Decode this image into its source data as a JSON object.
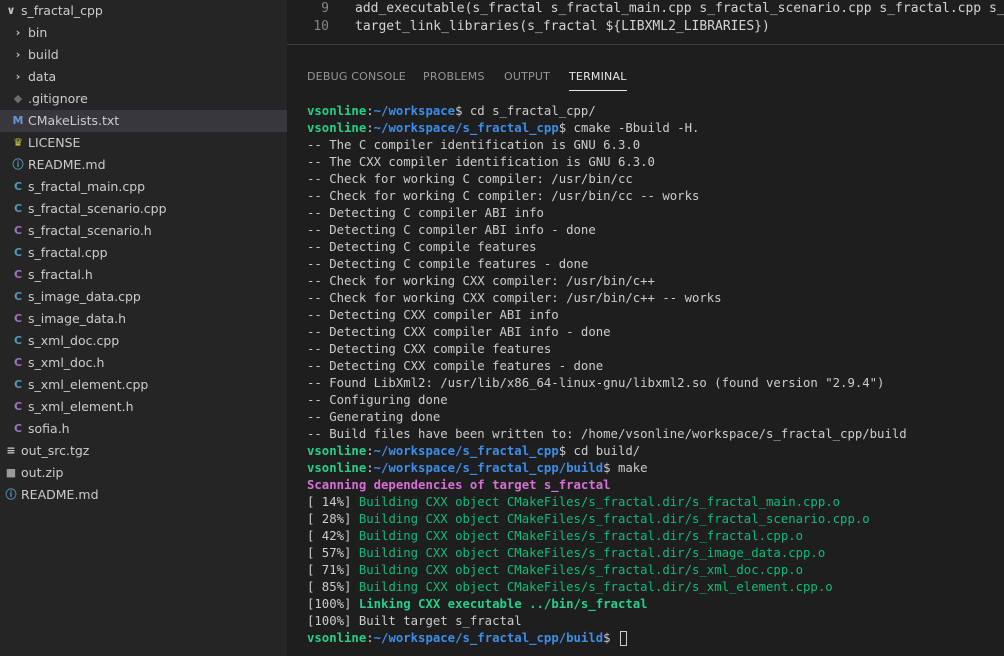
{
  "explorer": {
    "items": [
      {
        "label": "s_fractal_cpp",
        "icon": "chevron-down",
        "glyph": "∨",
        "color": "#c5c5c5",
        "level": 0
      },
      {
        "label": "bin",
        "icon": "chevron-right",
        "glyph": "›",
        "color": "#c5c5c5",
        "level": 1
      },
      {
        "label": "build",
        "icon": "chevron-right",
        "glyph": "›",
        "color": "#c5c5c5",
        "level": 1
      },
      {
        "label": "data",
        "icon": "chevron-right",
        "glyph": "›",
        "color": "#c5c5c5",
        "level": 1
      },
      {
        "label": ".gitignore",
        "icon": "git",
        "glyph": "◆",
        "color": "#6d6d6d",
        "level": 1
      },
      {
        "label": "CMakeLists.txt",
        "icon": "cmake",
        "glyph": "M",
        "color": "#6997d5",
        "level": 1,
        "selected": true
      },
      {
        "label": "LICENSE",
        "icon": "license",
        "glyph": "♛",
        "color": "#cbcb41",
        "level": 1
      },
      {
        "label": "README.md",
        "icon": "info",
        "glyph": "ⓘ",
        "color": "#519aba",
        "level": 1
      },
      {
        "label": "s_fractal_main.cpp",
        "icon": "cpp",
        "glyph": "C",
        "color": "#519aba",
        "level": 1
      },
      {
        "label": "s_fractal_scenario.cpp",
        "icon": "cpp",
        "glyph": "C",
        "color": "#519aba",
        "level": 1
      },
      {
        "label": "s_fractal_scenario.h",
        "icon": "header",
        "glyph": "C",
        "color": "#a074c4",
        "level": 1
      },
      {
        "label": "s_fractal.cpp",
        "icon": "cpp",
        "glyph": "C",
        "color": "#519aba",
        "level": 1
      },
      {
        "label": "s_fractal.h",
        "icon": "header",
        "glyph": "C",
        "color": "#a074c4",
        "level": 1
      },
      {
        "label": "s_image_data.cpp",
        "icon": "cpp",
        "glyph": "C",
        "color": "#519aba",
        "level": 1
      },
      {
        "label": "s_image_data.h",
        "icon": "header",
        "glyph": "C",
        "color": "#a074c4",
        "level": 1
      },
      {
        "label": "s_xml_doc.cpp",
        "icon": "cpp",
        "glyph": "C",
        "color": "#519aba",
        "level": 1
      },
      {
        "label": "s_xml_doc.h",
        "icon": "header",
        "glyph": "C",
        "color": "#a074c4",
        "level": 1
      },
      {
        "label": "s_xml_element.cpp",
        "icon": "cpp",
        "glyph": "C",
        "color": "#519aba",
        "level": 1
      },
      {
        "label": "s_xml_element.h",
        "icon": "header",
        "glyph": "C",
        "color": "#a074c4",
        "level": 1
      },
      {
        "label": "sofia.h",
        "icon": "header",
        "glyph": "C",
        "color": "#a074c4",
        "level": 1
      },
      {
        "label": "out_src.tgz",
        "icon": "archive",
        "glyph": "≡",
        "color": "#cccccc",
        "level": 0
      },
      {
        "label": "out.zip",
        "icon": "zip",
        "glyph": "■",
        "color": "#9a9a9a",
        "level": 0
      },
      {
        "label": "README.md",
        "icon": "info",
        "glyph": "ⓘ",
        "color": "#519aba",
        "level": 0
      }
    ]
  },
  "editor": {
    "lines": [
      {
        "num": "9",
        "text": "add_executable(s_fractal s_fractal_main.cpp s_fractal_scenario.cpp s_fractal.cpp s_image_data.cpp"
      },
      {
        "num": "10",
        "text": "target_link_libraries(s_fractal ${LIBXML2_LIBRARIES})"
      }
    ]
  },
  "panel": {
    "tabs": [
      {
        "label": "DEBUG CONSOLE",
        "active": false
      },
      {
        "label": "PROBLEMS",
        "active": false
      },
      {
        "label": "OUTPUT",
        "active": false
      },
      {
        "label": "TERMINAL",
        "active": true
      }
    ]
  },
  "terminal": {
    "lines": [
      [
        {
          "t": "vsonline",
          "c": "user"
        },
        {
          "t": ":"
        },
        {
          "t": "~/workspace",
          "c": "path"
        },
        {
          "t": "$ cd s_fractal_cpp/"
        }
      ],
      [
        {
          "t": "vsonline",
          "c": "user"
        },
        {
          "t": ":"
        },
        {
          "t": "~/workspace/s_fractal_cpp",
          "c": "path"
        },
        {
          "t": "$ cmake -Bbuild -H."
        }
      ],
      [
        {
          "t": "-- The C compiler identification is GNU 6.3.0"
        }
      ],
      [
        {
          "t": "-- The CXX compiler identification is GNU 6.3.0"
        }
      ],
      [
        {
          "t": "-- Check for working C compiler: /usr/bin/cc"
        }
      ],
      [
        {
          "t": "-- Check for working C compiler: /usr/bin/cc -- works"
        }
      ],
      [
        {
          "t": "-- Detecting C compiler ABI info"
        }
      ],
      [
        {
          "t": "-- Detecting C compiler ABI info - done"
        }
      ],
      [
        {
          "t": "-- Detecting C compile features"
        }
      ],
      [
        {
          "t": "-- Detecting C compile features - done"
        }
      ],
      [
        {
          "t": "-- Check for working CXX compiler: /usr/bin/c++"
        }
      ],
      [
        {
          "t": "-- Check for working CXX compiler: /usr/bin/c++ -- works"
        }
      ],
      [
        {
          "t": "-- Detecting CXX compiler ABI info"
        }
      ],
      [
        {
          "t": "-- Detecting CXX compiler ABI info - done"
        }
      ],
      [
        {
          "t": "-- Detecting CXX compile features"
        }
      ],
      [
        {
          "t": "-- Detecting CXX compile features - done"
        }
      ],
      [
        {
          "t": "-- Found LibXml2: /usr/lib/x86_64-linux-gnu/libxml2.so (found version \"2.9.4\")"
        }
      ],
      [
        {
          "t": "-- Configuring done"
        }
      ],
      [
        {
          "t": "-- Generating done"
        }
      ],
      [
        {
          "t": "-- Build files have been written to: /home/vsonline/workspace/s_fractal_cpp/build"
        }
      ],
      [
        {
          "t": "vsonline",
          "c": "user"
        },
        {
          "t": ":"
        },
        {
          "t": "~/workspace/s_fractal_cpp",
          "c": "path"
        },
        {
          "t": "$ cd build/"
        }
      ],
      [
        {
          "t": "vsonline",
          "c": "user"
        },
        {
          "t": ":"
        },
        {
          "t": "~/workspace/s_fractal_cpp/build",
          "c": "path"
        },
        {
          "t": "$ make"
        }
      ],
      [
        {
          "t": "Scanning dependencies of target s_fractal",
          "c": "mag"
        }
      ],
      [
        {
          "t": "[ 14%] "
        },
        {
          "t": "Building CXX object CMakeFiles/s_fractal.dir/s_fractal_main.cpp.o",
          "c": "green"
        }
      ],
      [
        {
          "t": "[ 28%] "
        },
        {
          "t": "Building CXX object CMakeFiles/s_fractal.dir/s_fractal_scenario.cpp.o",
          "c": "green"
        }
      ],
      [
        {
          "t": "[ 42%] "
        },
        {
          "t": "Building CXX object CMakeFiles/s_fractal.dir/s_fractal.cpp.o",
          "c": "green"
        }
      ],
      [
        {
          "t": "[ 57%] "
        },
        {
          "t": "Building CXX object CMakeFiles/s_fractal.dir/s_image_data.cpp.o",
          "c": "green"
        }
      ],
      [
        {
          "t": "[ 71%] "
        },
        {
          "t": "Building CXX object CMakeFiles/s_fractal.dir/s_xml_doc.cpp.o",
          "c": "green"
        }
      ],
      [
        {
          "t": "[ 85%] "
        },
        {
          "t": "Building CXX object CMakeFiles/s_fractal.dir/s_xml_element.cpp.o",
          "c": "green"
        }
      ],
      [
        {
          "t": "[100%] "
        },
        {
          "t": "Linking CXX executable ../bin/s_fractal",
          "c": "greenb"
        }
      ],
      [
        {
          "t": "[100%] Built target s_fractal"
        }
      ],
      [
        {
          "t": "vsonline",
          "c": "user"
        },
        {
          "t": ":"
        },
        {
          "t": "~/workspace/s_fractal_cpp/build",
          "c": "path"
        },
        {
          "t": "$ "
        }
      ]
    ]
  }
}
